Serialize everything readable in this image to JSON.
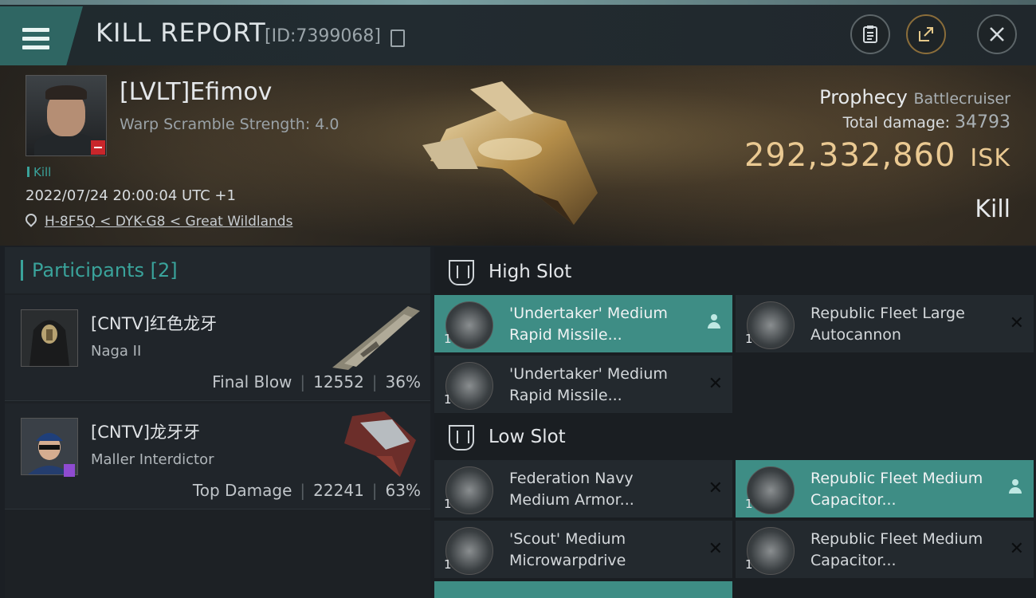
{
  "header": {
    "title": "KILL REPORT",
    "report_id": "[ID:7399068]",
    "buttons": [
      "clipboard-icon",
      "share-icon",
      "close-icon"
    ]
  },
  "victim": {
    "name": "[LVLT]Efimov",
    "warp_scramble": "Warp Scramble Strength: 4.0",
    "tag": "Kill",
    "datetime": "2022/07/24 20:00:04 UTC +1",
    "location": "H-8F5Q < DYK-G8 < Great Wildlands",
    "ship_name": "Prophecy",
    "ship_class": "Battlecruiser",
    "total_damage_label": "Total damage:",
    "total_damage": "34793",
    "isk_value": "292,332,860",
    "isk_unit": "ISK",
    "result": "Kill"
  },
  "participants": {
    "title": "Participants [2]",
    "rows": [
      {
        "name": "[CNTV]红色龙牙",
        "ship": "Naga II",
        "role": "Final Blow",
        "damage": "12552",
        "percent": "36%"
      },
      {
        "name": "[CNTV]龙牙牙",
        "ship": "Maller Interdictor",
        "role": "Top Damage",
        "damage": "22241",
        "percent": "63%"
      }
    ]
  },
  "fitting": {
    "high_slot_title": "High Slot",
    "low_slot_title": "Low Slot",
    "high_slots": [
      {
        "name": "'Undertaker' Medium Rapid Missile...",
        "qty": "1",
        "state": "active"
      },
      {
        "name": "Republic Fleet Large Autocannon",
        "qty": "1",
        "state": "destroyed"
      },
      {
        "name": "'Undertaker' Medium Rapid Missile...",
        "qty": "1",
        "state": "destroyed"
      }
    ],
    "low_slots": [
      {
        "name": "Federation Navy Medium Armor...",
        "qty": "1",
        "state": "destroyed"
      },
      {
        "name": "Republic Fleet Medium Capacitor...",
        "qty": "1",
        "state": "active"
      },
      {
        "name": "'Scout' Medium Microwarpdrive",
        "qty": "1",
        "state": "destroyed"
      },
      {
        "name": "Republic Fleet Medium Capacitor...",
        "qty": "1",
        "state": "destroyed"
      }
    ],
    "destroyed_mark": "✕"
  },
  "colors": {
    "accent_teal": "#3aa39b",
    "isk_gold": "#eac992",
    "active_slot": "#3e8d85"
  }
}
